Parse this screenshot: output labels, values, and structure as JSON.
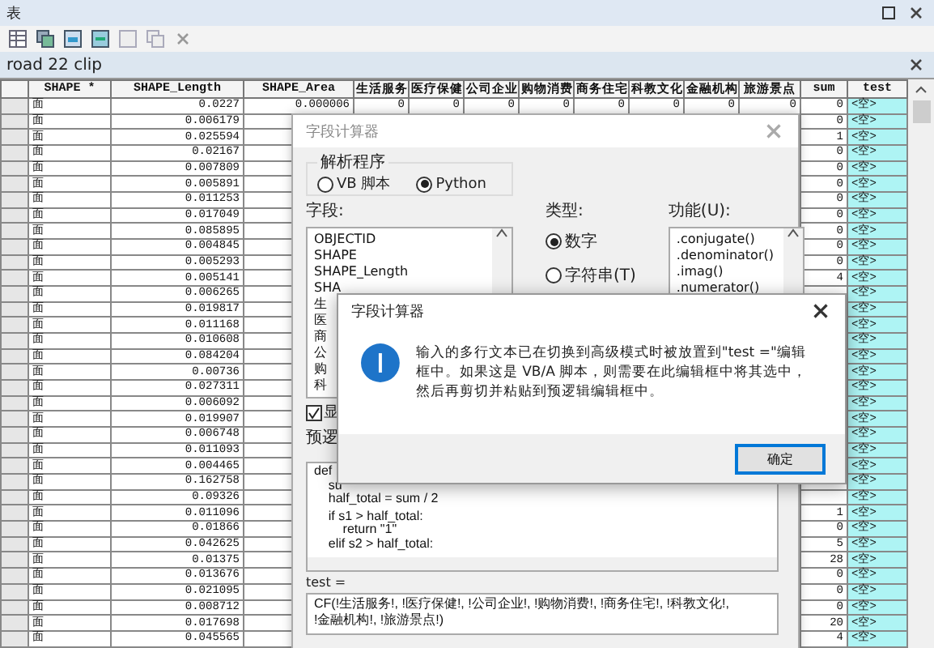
{
  "window": {
    "title": "表"
  },
  "table_title": "road 22 clip",
  "columns": [
    "SHAPE *",
    "SHAPE_Length",
    "SHAPE_Area",
    "生活服务",
    "医疗保健",
    "公司企业",
    "购物消费",
    "商务住宅",
    "科教文化",
    "金融机构",
    "旅游景点",
    "sum",
    "test"
  ],
  "rows": [
    {
      "shape": "面",
      "length": "0.0227",
      "area": "0.000006",
      "values": [
        "0",
        "0",
        "0",
        "0",
        "0",
        "0",
        "0",
        "0"
      ],
      "sum": "0",
      "test": "<空>"
    },
    {
      "shape": "面",
      "length": "0.006179",
      "sum": "0",
      "test": "<空>"
    },
    {
      "shape": "面",
      "length": "0.025594",
      "sum": "1",
      "test": "<空>"
    },
    {
      "shape": "面",
      "length": "0.02167",
      "sum": "0",
      "test": "<空>"
    },
    {
      "shape": "面",
      "length": "0.007809",
      "sum": "0",
      "test": "<空>"
    },
    {
      "shape": "面",
      "length": "0.005891",
      "sum": "0",
      "test": "<空>"
    },
    {
      "shape": "面",
      "length": "0.011253",
      "sum": "0",
      "test": "<空>"
    },
    {
      "shape": "面",
      "length": "0.017049",
      "sum": "0",
      "test": "<空>"
    },
    {
      "shape": "面",
      "length": "0.085895",
      "sum": "0",
      "test": "<空>"
    },
    {
      "shape": "面",
      "length": "0.004845",
      "sum": "0",
      "test": "<空>"
    },
    {
      "shape": "面",
      "length": "0.005293",
      "sum": "0",
      "test": "<空>"
    },
    {
      "shape": "面",
      "length": "0.005141",
      "sum": "4",
      "test": "<空>"
    },
    {
      "shape": "面",
      "length": "0.006265",
      "test": "<空>"
    },
    {
      "shape": "面",
      "length": "0.019817",
      "test": "<空>"
    },
    {
      "shape": "面",
      "length": "0.011168",
      "test": "<空>"
    },
    {
      "shape": "面",
      "length": "0.010608",
      "test": "<空>"
    },
    {
      "shape": "面",
      "length": "0.084204",
      "test": "<空>"
    },
    {
      "shape": "面",
      "length": "0.00736",
      "test": "<空>"
    },
    {
      "shape": "面",
      "length": "0.027311",
      "test": "<空>"
    },
    {
      "shape": "面",
      "length": "0.006092",
      "test": "<空>"
    },
    {
      "shape": "面",
      "length": "0.019907",
      "test": "<空>"
    },
    {
      "shape": "面",
      "length": "0.006748",
      "test": "<空>"
    },
    {
      "shape": "面",
      "length": "0.011093",
      "test": "<空>"
    },
    {
      "shape": "面",
      "length": "0.004465",
      "test": "<空>"
    },
    {
      "shape": "面",
      "length": "0.162758",
      "test": "<空>"
    },
    {
      "shape": "面",
      "length": "0.09326",
      "test": "<空>"
    },
    {
      "shape": "面",
      "length": "0.011096",
      "sum": "1",
      "test": "<空>"
    },
    {
      "shape": "面",
      "length": "0.01866",
      "sum": "0",
      "test": "<空>"
    },
    {
      "shape": "面",
      "length": "0.042625",
      "sum": "5",
      "test": "<空>"
    },
    {
      "shape": "面",
      "length": "0.01375",
      "sum": "28",
      "test": "<空>"
    },
    {
      "shape": "面",
      "length": "0.013676",
      "sum": "0",
      "test": "<空>"
    },
    {
      "shape": "面",
      "length": "0.021095",
      "sum": "0",
      "test": "<空>"
    },
    {
      "shape": "面",
      "length": "0.008712",
      "sum": "0",
      "test": "<空>"
    },
    {
      "shape": "面",
      "length": "0.017698",
      "sum": "20",
      "test": "<空>"
    },
    {
      "shape": "面",
      "length": "0.045565",
      "sum": "4",
      "test": "<空>"
    }
  ],
  "calculator": {
    "title": "字段计算器",
    "parser_label": "解析程序",
    "parsers": [
      {
        "label": "VB 脚本",
        "selected": false
      },
      {
        "label": "Python",
        "selected": true
      }
    ],
    "fields_label": "字段:",
    "fields": [
      "OBJECTID",
      "SHAPE",
      "SHAPE_Length",
      "SHA",
      "生",
      "医",
      "商",
      "公",
      "购",
      "科"
    ],
    "type_label": "类型:",
    "types": [
      {
        "label": "数字",
        "selected": true
      },
      {
        "label": "字符串(T)",
        "selected": false
      }
    ],
    "functions_label": "功能(U):",
    "functions": [
      ".conjugate()",
      ".denominator()",
      ".imag()",
      ".numerator()"
    ],
    "show_codeblock": {
      "label": "显",
      "checked": true
    },
    "codeblock_label": "预逻",
    "code": [
      [
        "def",
        "    su",
        "    half_total = sum / 2"
      ],
      [
        "    if s1 > half_total:",
        "        return \"1\"",
        "    elif s2 > half_total:"
      ]
    ],
    "expression_label": "test =",
    "expression": [
      "CF(!生活服务!, !医疗保健!, !公司企业!, !购物消费!, !商务住宅!, !科教文化!,",
      "!金融机构!, !旅游景点!)"
    ]
  },
  "message": {
    "title": "字段计算器",
    "text": "输入的多行文本已在切换到高级模式时被放置到\"test =\"编辑框中。如果这是 VB/A 脚本，则需要在此编辑框中将其选中，然后再剪切并粘贴到预逻辑编辑框中。",
    "ok": "确定"
  }
}
